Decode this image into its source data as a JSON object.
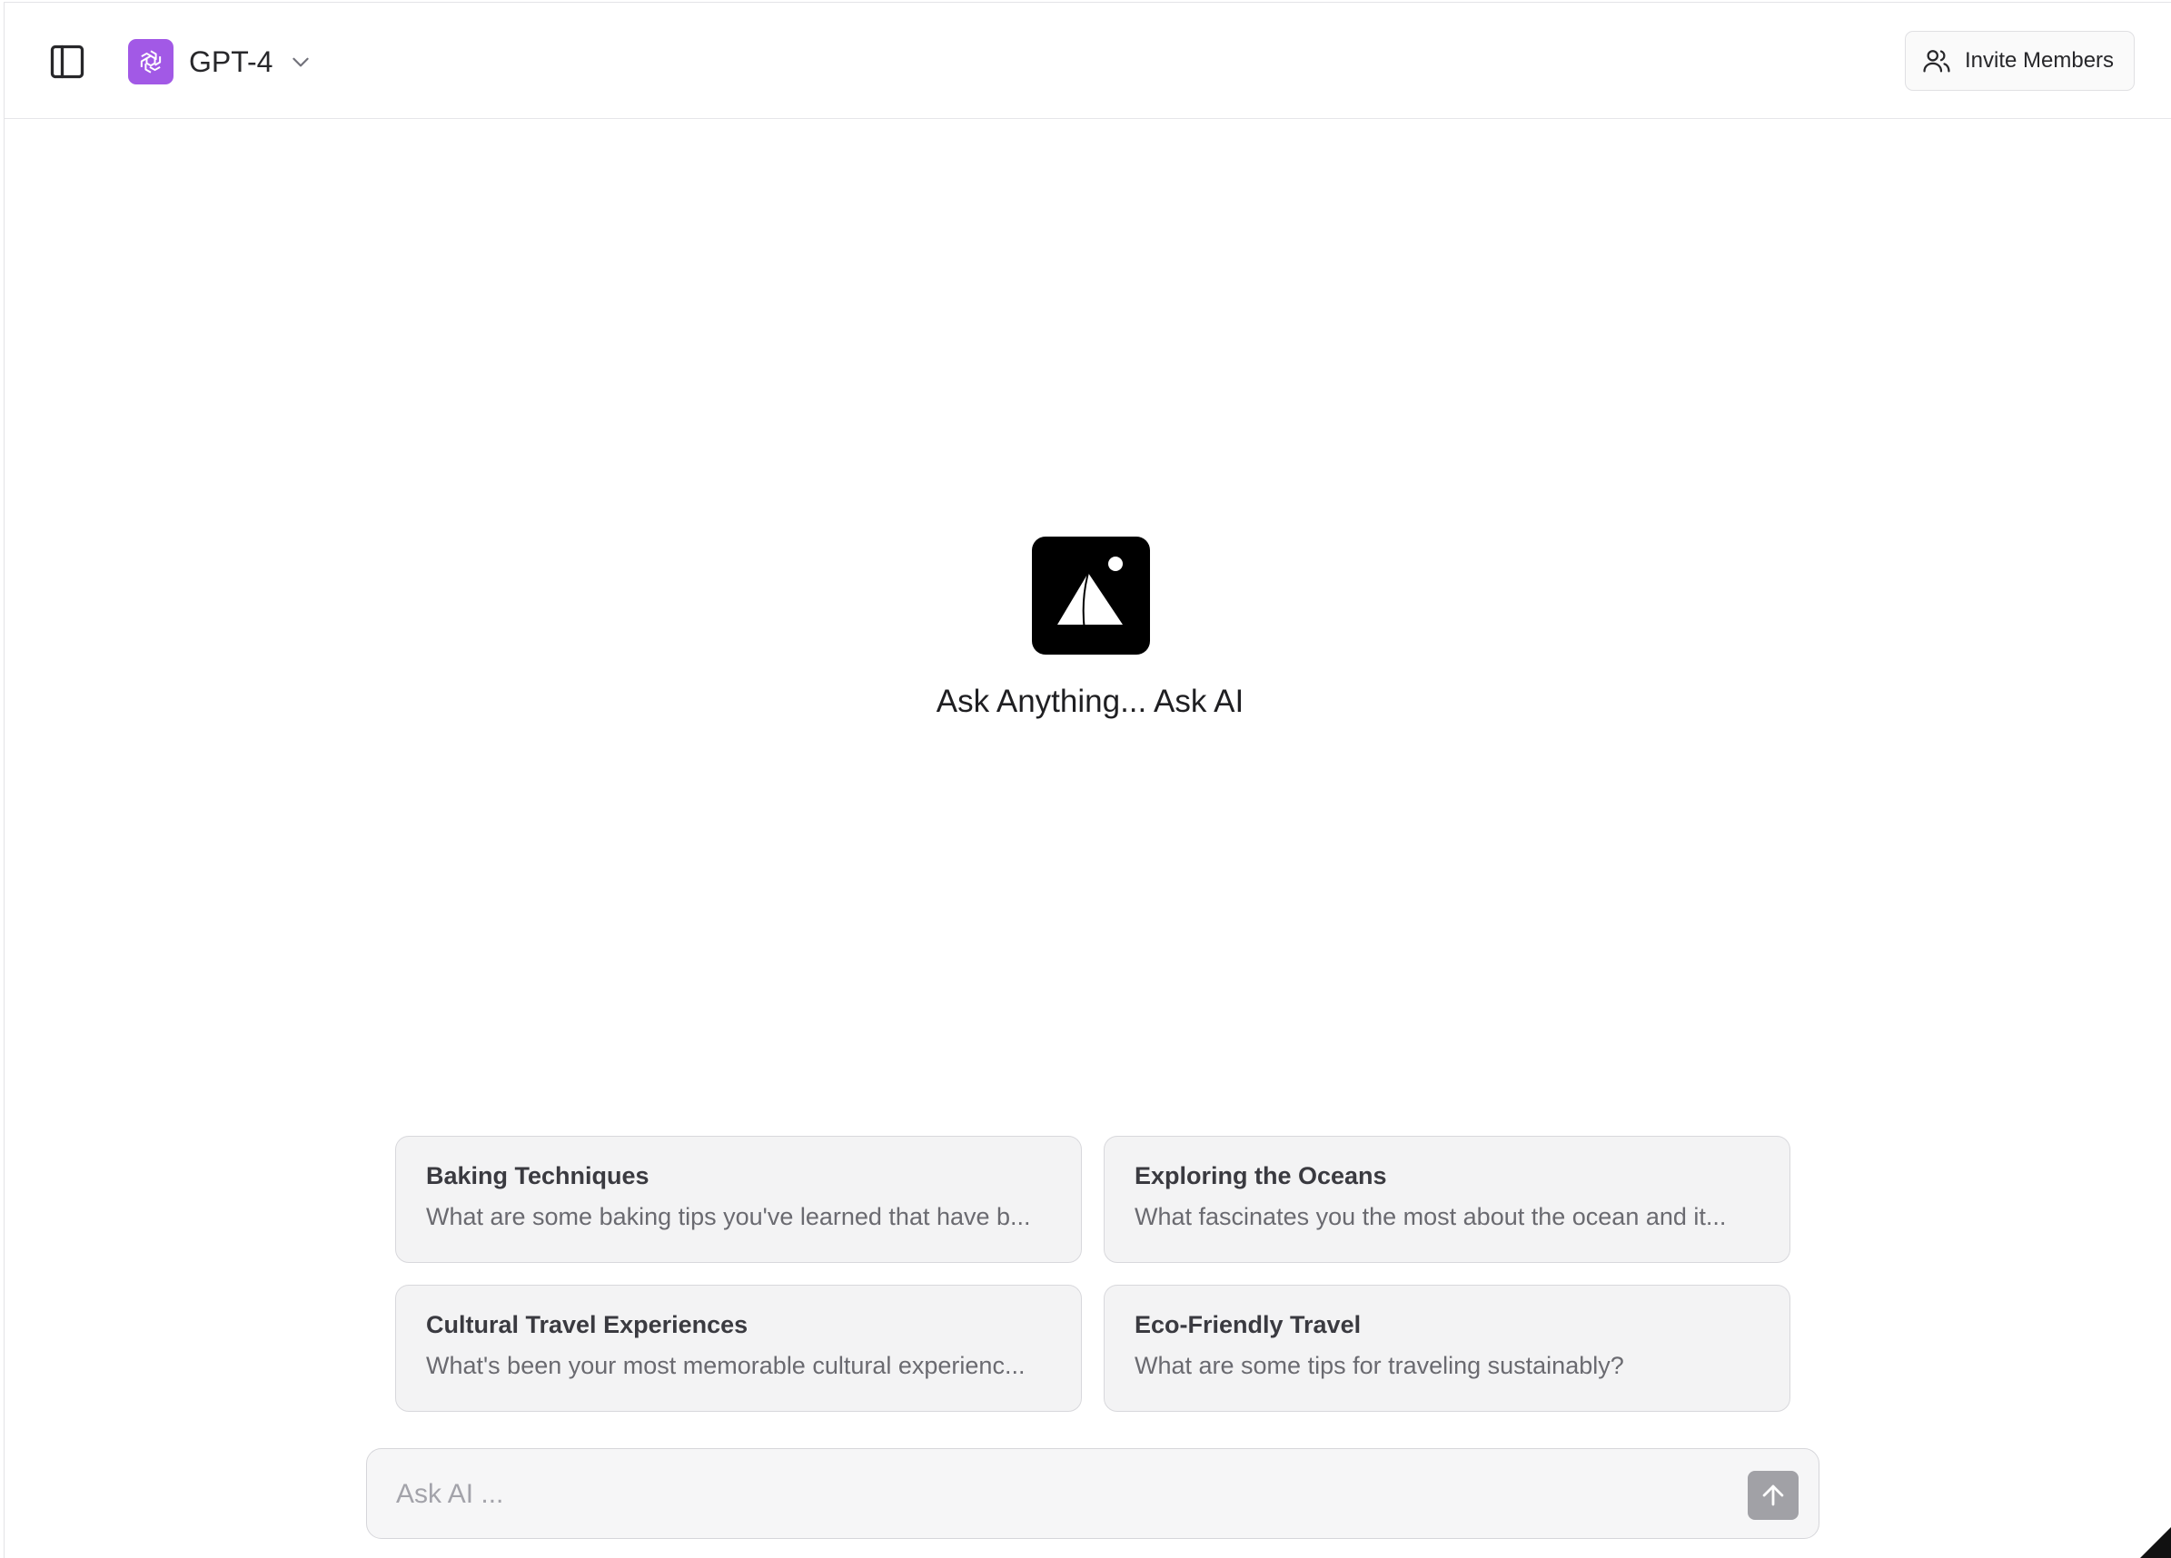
{
  "header": {
    "model": {
      "name": "GPT-4",
      "logo_color": "#a259e6",
      "icon": "openai-logo-icon"
    },
    "invite_button": {
      "label": "Invite Members",
      "icon": "users-icon"
    },
    "sidebar_toggle_icon": "sidebar-toggle-icon"
  },
  "hero": {
    "logo_icon": "sail-logo-icon",
    "headline": "Ask Anything... Ask AI"
  },
  "suggestions": [
    {
      "title": "Baking Techniques",
      "description": "What are some baking tips you've learned that have b..."
    },
    {
      "title": "Exploring the Oceans",
      "description": "What fascinates you the most about the ocean and it..."
    },
    {
      "title": "Cultural Travel Experiences",
      "description": "What's been your most memorable cultural experienc..."
    },
    {
      "title": "Eco-Friendly Travel",
      "description": "What are some tips for traveling sustainably?"
    }
  ],
  "composer": {
    "placeholder": "Ask AI ...",
    "value": "",
    "send_icon": "arrow-up-icon"
  }
}
